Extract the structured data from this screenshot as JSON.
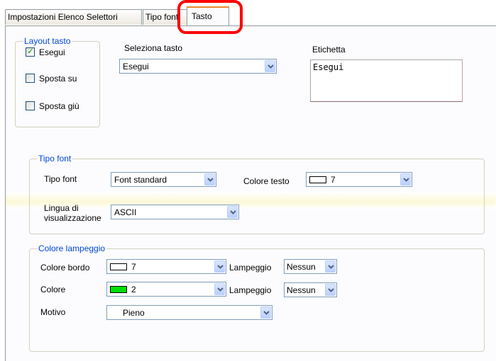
{
  "tabs": [
    {
      "label": "Impostazioni Elenco Selettori"
    },
    {
      "label": "Tipo font"
    },
    {
      "label": "Tasto"
    }
  ],
  "layout_tasto": {
    "title": "Layout tasto",
    "options": [
      {
        "label": "Esegui",
        "checked": true
      },
      {
        "label": "Sposta su",
        "checked": false
      },
      {
        "label": "Sposta giù",
        "checked": false
      }
    ]
  },
  "seleziona_tasto": {
    "label": "Seleziona tasto",
    "value": "Esegui"
  },
  "etichetta": {
    "label": "Etichetta",
    "value": "Esegui"
  },
  "tipo_font_group": {
    "title": "Tipo font",
    "font_label": "Tipo font",
    "font_value": "Font standard",
    "color_label": "Colore testo",
    "color_value": "7",
    "color_swatch": "#ffffff",
    "lang_label_1": "Lingua di",
    "lang_label_2": "visualizzazione",
    "lang_value": "ASCII"
  },
  "colore_lampeggio": {
    "title": "Colore lampeggio",
    "border_label": "Colore bordo",
    "border_value": "7",
    "border_swatch": "#ffffff",
    "blink_label_1": "Lampeggio",
    "blink_value_1": "Nessun",
    "color_label": "Colore",
    "color_value": "2",
    "color_swatch": "#00e000",
    "blink_label_2": "Lampeggio",
    "blink_value_2": "Nessun",
    "pattern_label": "Motivo",
    "pattern_value": "Pieno"
  }
}
